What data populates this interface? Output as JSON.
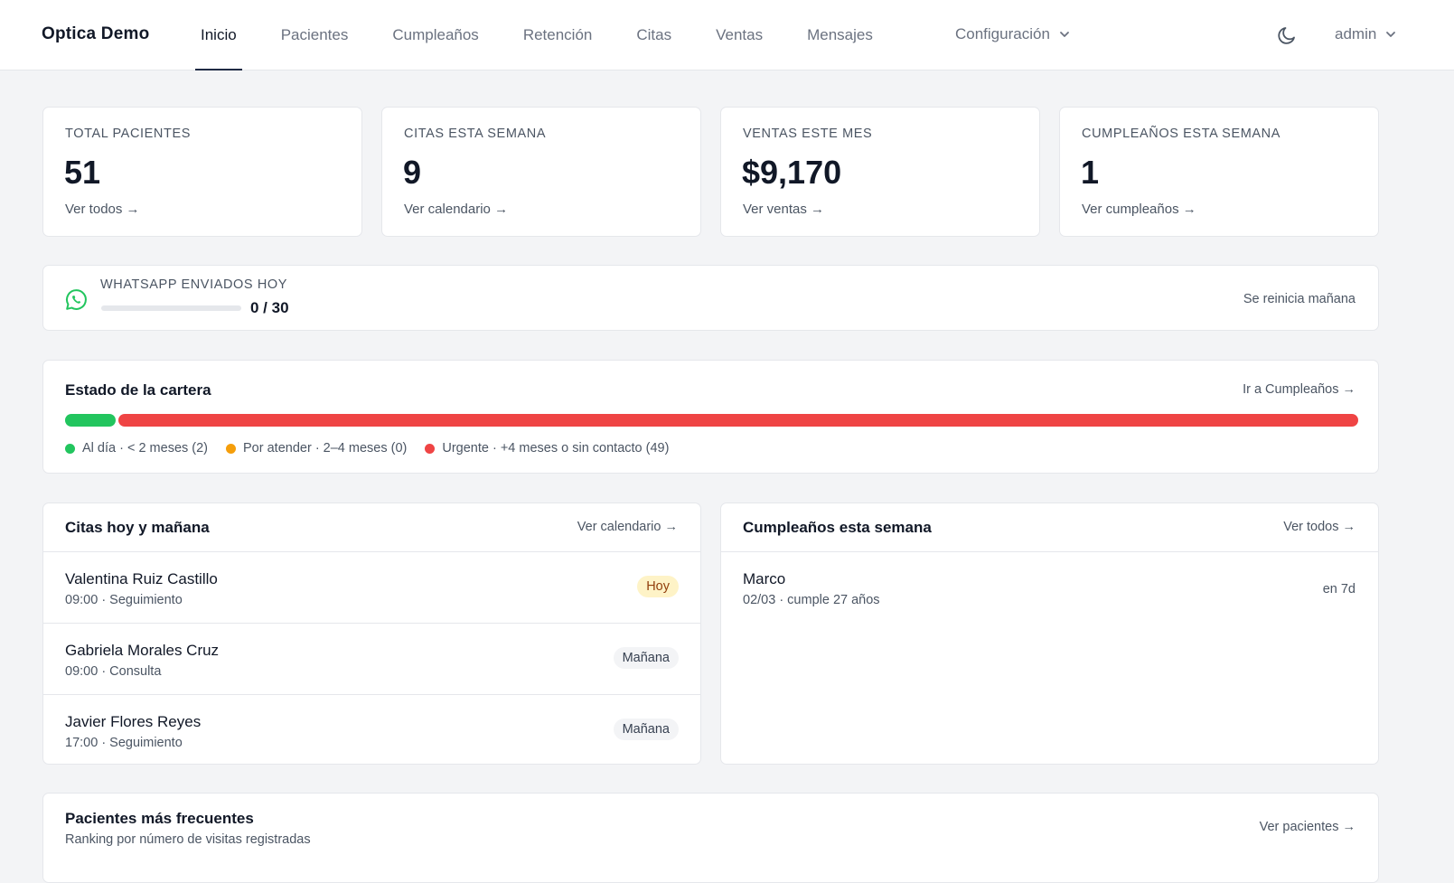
{
  "nav": {
    "brand": "Optica Demo",
    "items": [
      {
        "label": "Inicio",
        "active": true
      },
      {
        "label": "Pacientes"
      },
      {
        "label": "Cumpleaños"
      },
      {
        "label": "Retención"
      },
      {
        "label": "Citas"
      },
      {
        "label": "Ventas"
      },
      {
        "label": "Mensajes"
      }
    ],
    "config_label": "Configuración",
    "user_label": "admin",
    "theme_icon": "moon-icon"
  },
  "stats": [
    {
      "label": "TOTAL PACIENTES",
      "value": "51",
      "link": "Ver todos →"
    },
    {
      "label": "CITAS ESTA SEMANA",
      "value": "9",
      "link": "Ver calendario →"
    },
    {
      "label": "VENTAS ESTE MES",
      "value": "$9,170",
      "link": "Ver ventas →"
    },
    {
      "label": "CUMPLEAÑOS ESTA SEMANA",
      "value": "1",
      "link": "Ver cumpleaños →"
    }
  ],
  "whatsapp": {
    "label": "WHATSAPP ENVIADOS HOY",
    "count": "0 / 30",
    "sent": 0,
    "limit": 30,
    "reset_note": "Se reinicia mañana",
    "icon": "whatsapp-icon",
    "color": "#22c55e"
  },
  "portfolio": {
    "title": "Estado de la cartera",
    "link": "Ir a Cumpleaños →",
    "segments": [
      {
        "key": "al_dia",
        "count": 2,
        "color": "#22c55e",
        "legend": "Al día · < 2 meses (2)"
      },
      {
        "key": "por_atender",
        "count": 0,
        "color": "#f59e0b",
        "legend": "Por atender · 2–4 meses (0)"
      },
      {
        "key": "urgente",
        "count": 49,
        "color": "#ef4444",
        "legend": "Urgente · +4 meses o sin contacto (49)"
      }
    ]
  },
  "appointments": {
    "title": "Citas hoy y mañana",
    "link": "Ver calendario →",
    "rows": [
      {
        "name": "Valentina Ruiz Castillo",
        "detail": "09:00 · Seguimiento",
        "badge": "Hoy",
        "badge_type": "today"
      },
      {
        "name": "Gabriela Morales Cruz",
        "detail": "09:00 · Consulta",
        "badge": "Mañana",
        "badge_type": "tomorrow"
      },
      {
        "name": "Javier Flores Reyes",
        "detail": "17:00 · Seguimiento",
        "badge": "Mañana",
        "badge_type": "tomorrow"
      }
    ]
  },
  "birthdays": {
    "title": "Cumpleaños esta semana",
    "link": "Ver todos →",
    "rows": [
      {
        "name": "Marco",
        "detail": "02/03 · cumple 27 años",
        "when": "en 7d"
      }
    ]
  },
  "frequent": {
    "title": "Pacientes más frecuentes",
    "subtitle": "Ranking por número de visitas registradas",
    "link": "Ver pacientes →"
  }
}
